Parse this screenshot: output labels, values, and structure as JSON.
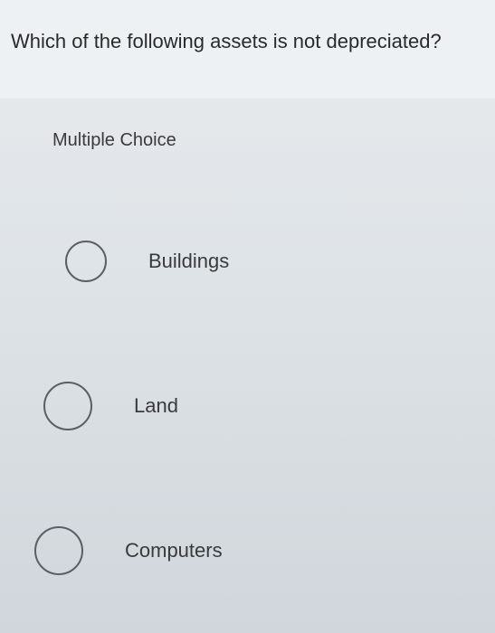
{
  "question": {
    "text": "Which of the following assets is not depreciated?"
  },
  "section_label": "Multiple Choice",
  "options": [
    {
      "label": "Buildings"
    },
    {
      "label": "Land"
    },
    {
      "label": "Computers"
    }
  ]
}
